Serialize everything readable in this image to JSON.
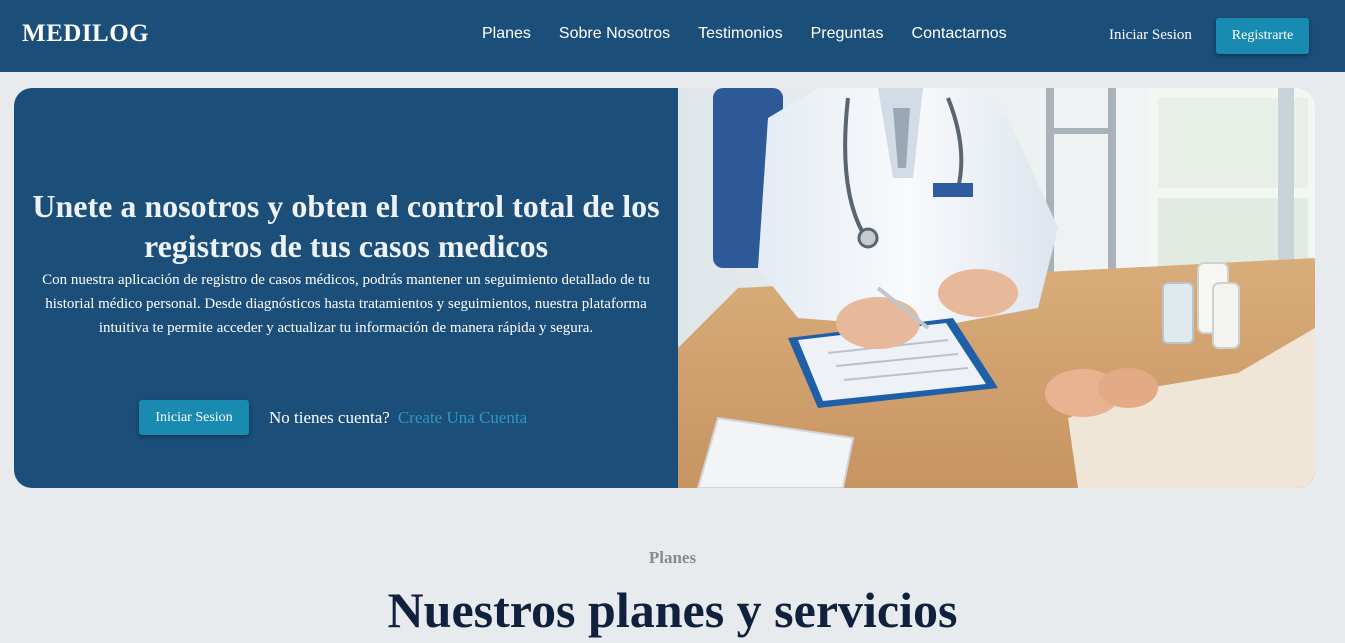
{
  "nav": {
    "brand": "MEDILOG",
    "links": [
      "Planes",
      "Sobre Nosotros",
      "Testimonios",
      "Preguntas",
      "Contactarnos"
    ],
    "login": "Iniciar Sesion",
    "register": "Registrarte"
  },
  "hero": {
    "title": "Unete a nosotros y obten el control total de los registros de tus casos medicos",
    "description": "Con nuestra aplicación de registro de casos médicos, podrás mantener un seguimiento detallado de tu historial médico personal. Desde diagnósticos hasta tratamientos y seguimientos, nuestra plataforma intuitiva te permite acceder y actualizar tu información de manera rápida y segura.",
    "login_button": "Iniciar Sesion",
    "no_account": "No tienes cuenta?",
    "create_account": "Create Una Cuenta"
  },
  "plans": {
    "label": "Planes",
    "title": "Nuestros planes y servicios"
  },
  "colors": {
    "primary": "#1b4e78",
    "accent": "#1a8bb0",
    "link": "#2a9bc4",
    "background": "#e8ebee"
  }
}
